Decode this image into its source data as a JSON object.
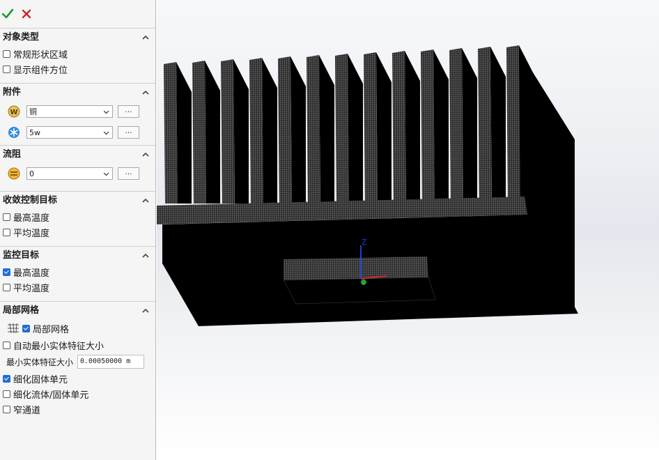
{
  "toolbar": {
    "ok_glyph": "✔",
    "cancel_glyph": "✖"
  },
  "sections": {
    "object_type": {
      "title": "对象类型",
      "regular_region": "常规形状区域",
      "show_component_orientation": "显示组件方位"
    },
    "attachments": {
      "title": "附件",
      "material_value": "铜",
      "heat_source_value": "5w",
      "more": "…"
    },
    "flow_resistance": {
      "title": "流阻",
      "value": "0",
      "more": "…"
    },
    "convergence_goals": {
      "title": "收敛控制目标",
      "max_temp": "最高温度",
      "avg_temp": "平均温度"
    },
    "monitor_goals": {
      "title": "监控目标",
      "max_temp": "最高温度",
      "avg_temp": "平均温度"
    },
    "local_mesh": {
      "title": "局部网格",
      "local_mesh_label": "局部网格",
      "auto_min_feature": "自动最小实体特征大小",
      "min_feature_label": "最小实体特征大小",
      "min_feature_value": "0.00050000 m",
      "refine_solid": "细化固体单元",
      "refine_fluid_solid": "细化流体/固体单元",
      "narrow_channel": "窄通道"
    }
  },
  "checkbox_states": {
    "regular_region": false,
    "show_component_orientation": false,
    "conv_max_temp": false,
    "conv_avg_temp": false,
    "mon_max_temp": true,
    "mon_avg_temp": false,
    "local_mesh": true,
    "auto_min_feature": false,
    "refine_solid": true,
    "refine_fluid_solid": false,
    "narrow_channel": false
  },
  "viewport": {
    "axis_label": "Z",
    "model": "heatsink-mesh",
    "fin_count": 13
  },
  "colors": {
    "accent": "#1e6fd1",
    "ok": "#1a9a3a",
    "cancel": "#d0232a",
    "mesh": "#000000"
  }
}
